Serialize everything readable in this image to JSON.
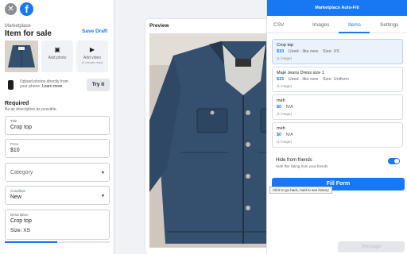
{
  "header": {
    "section_label": "Marketplace",
    "title": "Item for sale",
    "save_draft": "Save Draft"
  },
  "photos": {
    "add_photo": "Add photo",
    "add_video": "Add video",
    "video_note": "(1 minute max)"
  },
  "upload": {
    "text": "Upload photos directly from your phone.",
    "learn_more": "Learn more",
    "try_label": "Try it"
  },
  "required": {
    "title": "Required",
    "subtitle": "Be as descriptive as possible."
  },
  "form": {
    "title_label": "Title",
    "title_value": "Crop top",
    "price_label": "Price",
    "price_value": "$10",
    "category_placeholder": "Category",
    "condition_label": "Condition",
    "condition_value": "New",
    "description_label": "Description",
    "description_value": "Crop top",
    "description_size": "Size: XS",
    "progress_fraction": 0.5
  },
  "preview": {
    "title": "Preview"
  },
  "extension": {
    "title": "Marketplace Auto-Fill",
    "tabs": [
      "CSV",
      "Images",
      "Items",
      "Settings"
    ],
    "active_tab": "Items",
    "items": [
      {
        "name": "Crop top",
        "price": "$10",
        "condition": "Used - like new",
        "size": "Size: XS",
        "count": "(1 image)"
      },
      {
        "name": "Majé Jeans Dress size 1",
        "price": "$15",
        "condition": "Used - like new",
        "size": "Size: Uniform",
        "count": "(1 image)"
      },
      {
        "name": "meh",
        "price": "$0",
        "condition": "N/A",
        "size": "",
        "count": "(1 image)"
      },
      {
        "name": "meh",
        "price": "$0",
        "condition": "N/A",
        "size": "",
        "count": "(1 image)"
      }
    ],
    "hide_title": "Hide from friends",
    "hide_sub": "Hide this listing from your friends",
    "hide_enabled": true,
    "fill_button": "Fill Form",
    "tooltip": "Click to go back, hold to see history",
    "message_button": "Message"
  },
  "colors": {
    "brand": "#1877f2",
    "denim": "#35506f"
  },
  "icons": {
    "close": "close-icon",
    "logo": "facebook-logo",
    "add_photo": "add-photo-icon",
    "add_video": "add-video-icon",
    "phone": "phone-icon",
    "dropdown": "chevron-down-icon"
  }
}
